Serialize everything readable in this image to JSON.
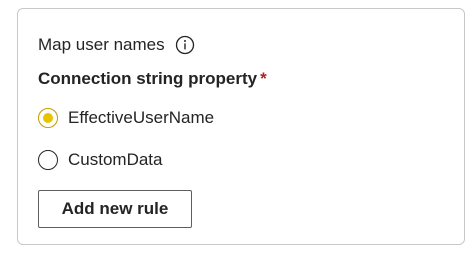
{
  "section": {
    "title": "Map user names",
    "info_icon": "info-circle-icon"
  },
  "connection": {
    "label": "Connection string property",
    "required_marker": "*",
    "options": [
      {
        "label": "EffectiveUserName",
        "selected": true
      },
      {
        "label": "CustomData",
        "selected": false
      }
    ]
  },
  "actions": {
    "add_rule_label": "Add new rule"
  },
  "colors": {
    "accent": "#e8c400",
    "required": "#a4262c",
    "text": "#252423",
    "border": "#c8c8c8"
  }
}
